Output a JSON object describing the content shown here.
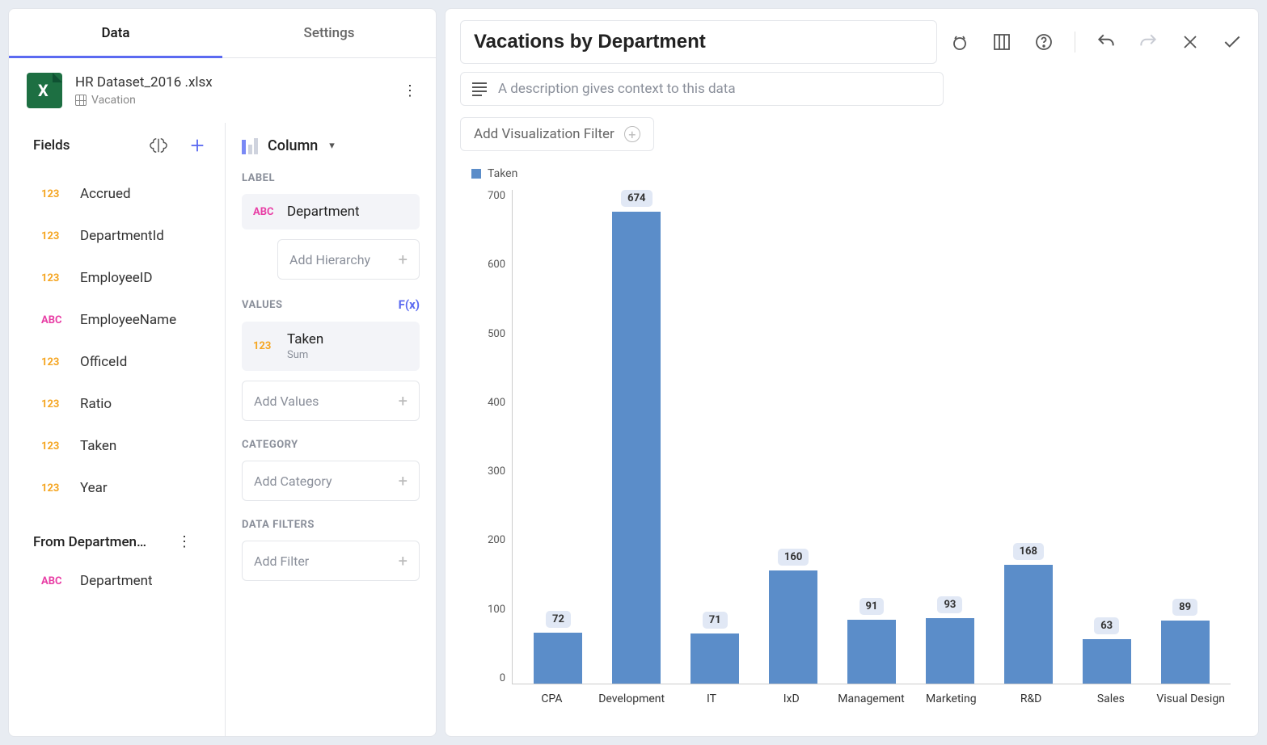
{
  "tabs": {
    "data": "Data",
    "settings": "Settings"
  },
  "datasource": {
    "filename": "HR Dataset_2016 .xlsx",
    "table": "Vacation"
  },
  "fields": {
    "header": "Fields",
    "list": [
      {
        "type": "num",
        "name": "Accrued"
      },
      {
        "type": "num",
        "name": "DepartmentId"
      },
      {
        "type": "num",
        "name": "EmployeeID"
      },
      {
        "type": "abc",
        "name": "EmployeeName"
      },
      {
        "type": "num",
        "name": "OfficeId"
      },
      {
        "type": "num",
        "name": "Ratio"
      },
      {
        "type": "num",
        "name": "Taken"
      },
      {
        "type": "num",
        "name": "Year"
      }
    ],
    "joined_header": "From Departmen…",
    "joined_list": [
      {
        "type": "abc",
        "name": "Department"
      }
    ]
  },
  "config": {
    "viz_type": "Column",
    "label_header": "LABEL",
    "label_field": "Department",
    "add_hierarchy": "Add Hierarchy",
    "values_header": "VALUES",
    "fx": "F(x)",
    "value_field": "Taken",
    "value_agg": "Sum",
    "add_values": "Add Values",
    "category_header": "CATEGORY",
    "add_category": "Add Category",
    "filters_header": "DATA FILTERS",
    "add_filter": "Add Filter"
  },
  "header": {
    "title": "Vacations by Department",
    "desc_placeholder": "A description gives context to this data",
    "add_viz_filter": "Add Visualization Filter"
  },
  "type_labels": {
    "num": "123",
    "abc": "ABC"
  },
  "chart_data": {
    "type": "bar",
    "title": "Vacations by Department",
    "legend": "Taken",
    "ylim": [
      0,
      700
    ],
    "yticks": [
      0,
      100,
      200,
      300,
      400,
      500,
      600,
      700
    ],
    "categories": [
      "CPA",
      "Development",
      "IT",
      "IxD",
      "Management",
      "Marketing",
      "R&D",
      "Sales",
      "Visual Design"
    ],
    "values": [
      72,
      674,
      71,
      160,
      91,
      93,
      168,
      63,
      89
    ]
  }
}
